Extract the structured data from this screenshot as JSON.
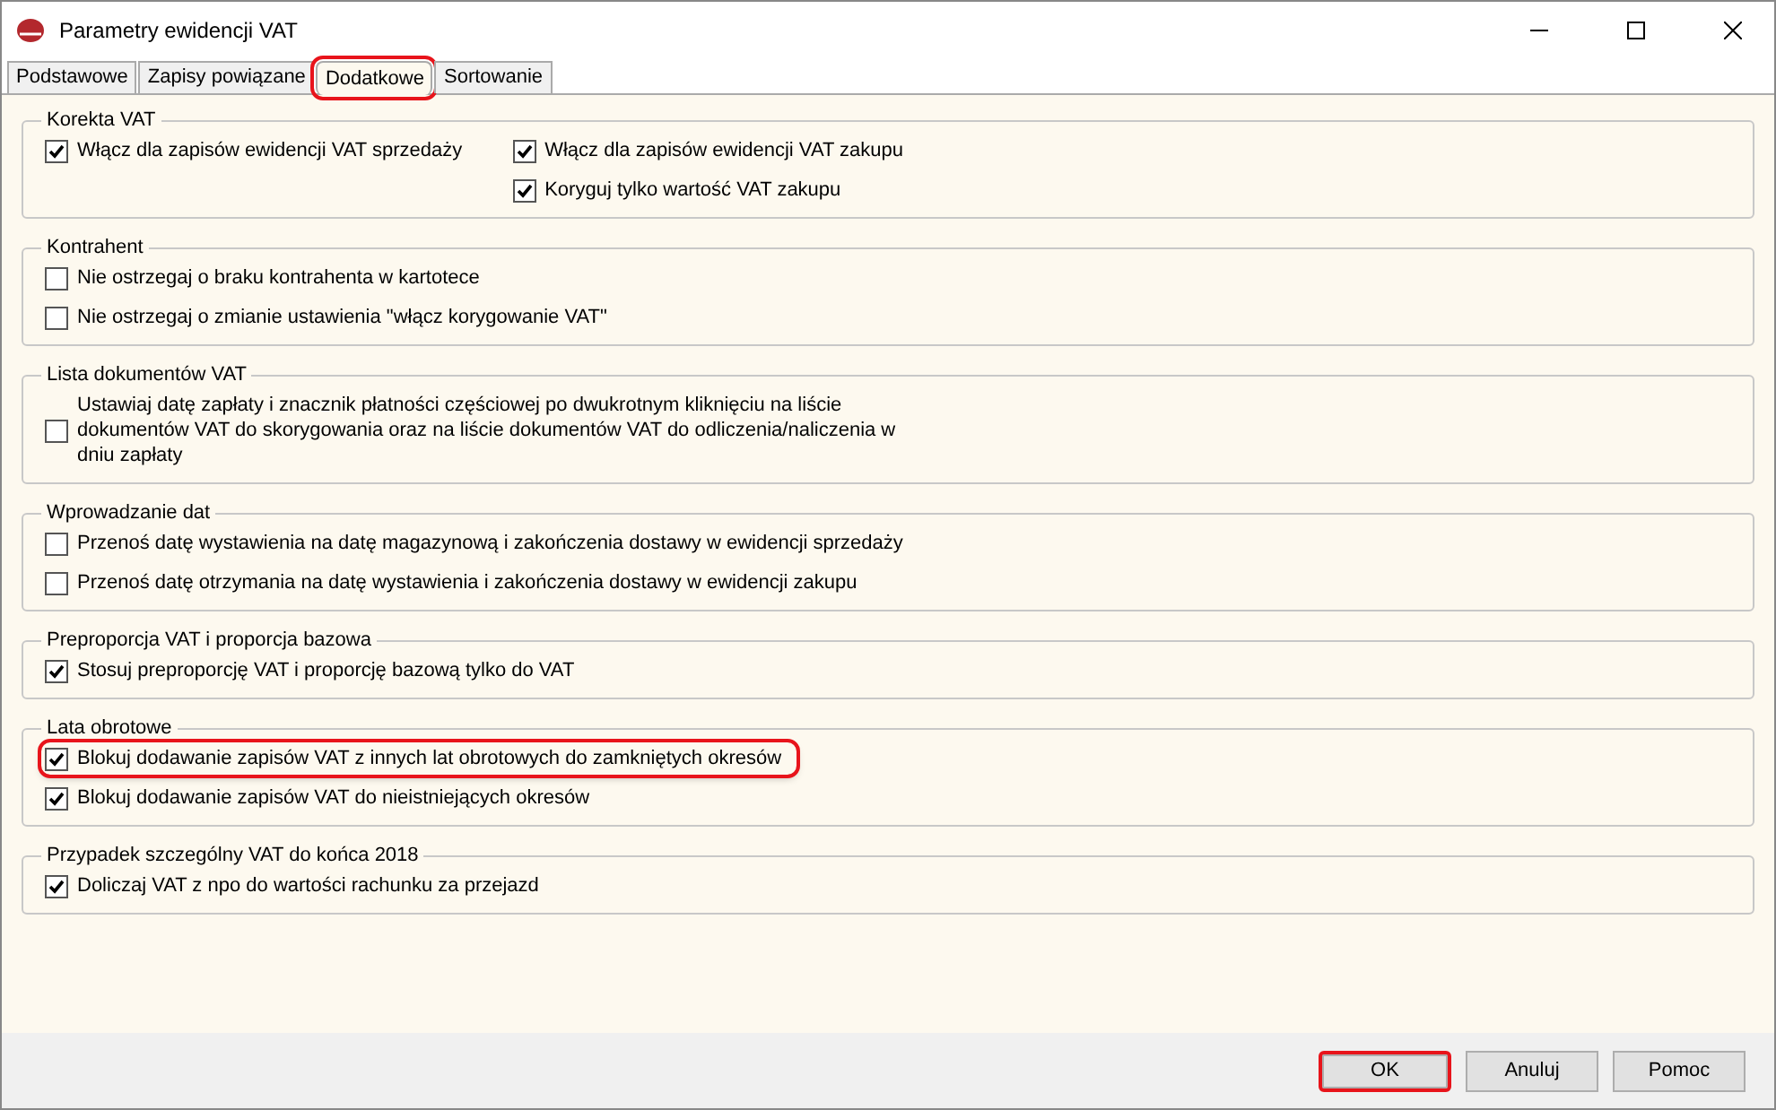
{
  "window": {
    "title": "Parametry ewidencji VAT"
  },
  "tabs": [
    {
      "label": "Podstawowe",
      "selected": false,
      "highlighted": false
    },
    {
      "label": "Zapisy powiązane",
      "selected": false,
      "highlighted": false
    },
    {
      "label": "Dodatkowe",
      "selected": true,
      "highlighted": true
    },
    {
      "label": "Sortowanie",
      "selected": false,
      "highlighted": false
    }
  ],
  "groups": [
    {
      "title": "Korekta VAT",
      "columns": [
        [
          {
            "label": "Włącz dla zapisów ewidencji VAT sprzedaży",
            "checked": true,
            "highlighted": false
          }
        ],
        [
          {
            "label": "Włącz dla zapisów ewidencji VAT zakupu",
            "checked": true,
            "highlighted": false
          },
          {
            "label": "Koryguj tylko wartość VAT zakupu",
            "checked": true,
            "highlighted": false
          }
        ]
      ]
    },
    {
      "title": "Kontrahent",
      "columns": [
        [
          {
            "label": "Nie ostrzegaj o braku kontrahenta w kartotece",
            "checked": false,
            "highlighted": false
          },
          {
            "label": "Nie ostrzegaj o zmianie ustawienia \"włącz korygowanie VAT\"",
            "checked": false,
            "highlighted": false
          }
        ]
      ]
    },
    {
      "title": "Lista dokumentów VAT",
      "columns": [
        [
          {
            "label": "Ustawiaj datę zapłaty i znacznik płatności częściowej po dwukrotnym kliknięciu na liście dokumentów VAT do skorygowania oraz na liście dokumentów VAT do odliczenia/naliczenia w dniu zapłaty",
            "checked": false,
            "highlighted": false
          }
        ]
      ]
    },
    {
      "title": "Wprowadzanie dat",
      "columns": [
        [
          {
            "label": "Przenoś datę wystawienia na datę magazynową i zakończenia dostawy w ewidencji sprzedaży",
            "checked": false,
            "highlighted": false
          },
          {
            "label": "Przenoś datę otrzymania na datę wystawienia i zakończenia dostawy w ewidencji zakupu",
            "checked": false,
            "highlighted": false
          }
        ]
      ]
    },
    {
      "title": "Preproporcja VAT i proporcja bazowa",
      "columns": [
        [
          {
            "label": "Stosuj preproporcję VAT i proporcję bazową tylko do VAT",
            "checked": true,
            "highlighted": false
          }
        ]
      ]
    },
    {
      "title": "Lata obrotowe",
      "columns": [
        [
          {
            "label": "Blokuj dodawanie zapisów VAT z innych lat obrotowych do zamkniętych okresów",
            "checked": true,
            "highlighted": true
          },
          {
            "label": "Blokuj dodawanie zapisów VAT do nieistniejących okresów",
            "checked": true,
            "highlighted": false
          }
        ]
      ]
    },
    {
      "title": "Przypadek szczególny VAT do końca 2018",
      "columns": [
        [
          {
            "label": "Doliczaj VAT z npo do wartości rachunku za przejazd",
            "checked": true,
            "highlighted": false
          }
        ]
      ]
    }
  ],
  "buttons": [
    {
      "label": "OK",
      "highlighted": true
    },
    {
      "label": "Anuluj",
      "highlighted": false
    },
    {
      "label": "Pomoc",
      "highlighted": false
    }
  ]
}
